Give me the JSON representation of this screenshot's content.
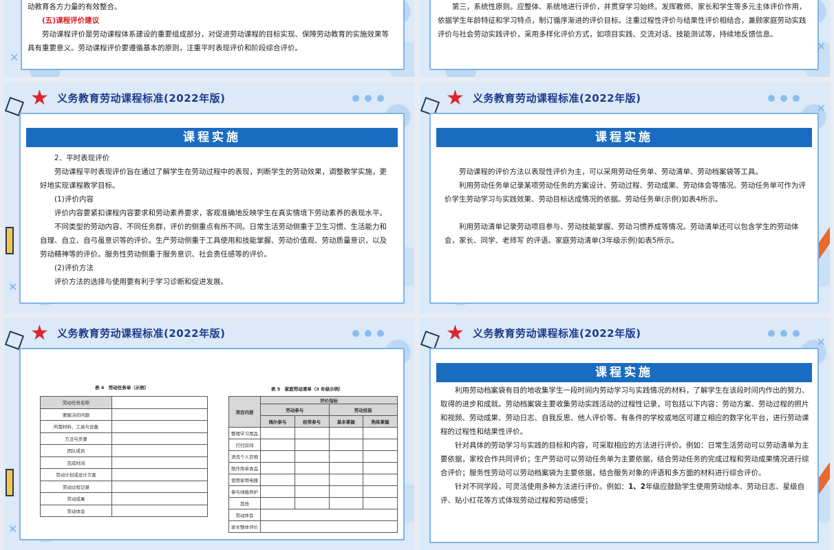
{
  "header_title": "义务教育劳动课程标准(2022年版)",
  "banner": "课程实施",
  "slide1": {
    "line1": "动教育各方力量的有效整合。",
    "heading": "(五)课程评价建议",
    "para": "劳动课程评价是劳动课程体系建设的重要组成部分，对促进劳动课程的目标实现、保障劳动教育的实施效果等具有重要意义。劳动课程评价要遵循基本的原则，注重平时表现评价和阶段综合评价。"
  },
  "slide2": {
    "para": "第三，系统性原则。应整体、系统地进行评价，并贯穿学习始终。发挥教师、家长和学生等多元主体评价作用，依据学生年龄特征和学习特点，制订循序渐进的评价目标。注重过程性评价与结果性评价相结合，兼顾家庭劳动实践评价与社会劳动实践评价，采用多样化评价方式，如项目实践、交流对话、技能测试等，持续地反馈信息。"
  },
  "slide3": {
    "h1": "2．平时表现评价",
    "p1": "劳动课程平时表现评价旨在通过了解学生在劳动过程中的表现，判断学生的劳动效果，调整教学实施，更好地实现课程教学目标。",
    "h2": "(1)评价内容",
    "p2": "评价内容要紧扣课程内容要求和劳动素养要求，客观准确地反映学生在真实情境下劳动素养的表现水平。",
    "p3": "不同类型的劳动内容、不同任务群，评价的侧重点有所不同。日常生活劳动侧重于卫生习惯、生活能力和自理、自立、自弓虽意识等的评价。生产劳动侧重于工具使用和技能掌握、劳动价值观、劳动质量意识，以及劳动精神等的评价。服务性劳动侧重于服务意识、社会责任感等的评价。",
    "h3": "(2)评价方法",
    "p4": "评价方法的选择与使用要有利于学习诊断和促进发展。"
  },
  "slide4": {
    "p1": "劳动课程的评价方法以表现性评价为主，可以采用劳动任务单、劳动清单、劳动档案袋等工具。",
    "p2": "利用劳动任务单记录某项劳动任务的方案设计、劳动过程、劳动成果、劳动体会等情况。劳动任务单可作为评价学生劳动学习与实践效果、劳动目标达成情况的依据。劳动任务单(示例)如表4所示。",
    "p3": "利用劳动清单记录劳动项目参与、劳动技能掌握、劳动习惯养成等情况。劳动清单还可以包含学生的劳动体会，家长、同学、老师写 的评语。家庭劳动清单(3年级示例)如表5所示。"
  },
  "slide5": {
    "table4": {
      "caption": "表 4　劳动任务单（示例）",
      "header": "劳动任务名称",
      "rows": [
        "要解决的问题",
        "所需材料、工具与设备",
        "方法与步骤",
        "团队成员",
        "完成时间",
        "劳动计划或设计方案",
        "劳动过程记录",
        "劳动成果",
        "劳动体会"
      ]
    },
    "table5": {
      "caption": "表 5　家庭劳动清单（3 年级示例）",
      "col_item": "项目内容",
      "col_index": "评价指标",
      "col_part": "劳动参与",
      "col_skill": "劳动技能",
      "sub": [
        "偶尔参与",
        "经常参与",
        "基本掌握",
        "熟练掌握"
      ],
      "rows": [
        "整理学习用品",
        "打扫房间",
        "清洗个人衣物",
        "制作简单食品",
        "使用家用电器",
        "参与绿植养护",
        "其他"
      ],
      "foot1": "劳动体会",
      "foot2": "家长整体评价"
    }
  },
  "slide6": {
    "p1": "利用劳动档案袋有目的地收集学生一段时间内劳动学习与实践情况的材料，了解学生在该段时间内作出的努力、取得的进步和成就。劳动档案袋主要收集劳动实践活动的过程性记录，可包括以下内容：劳动方案、劳动过程的照片和视频、劳动成果、劳动日志、自我反思、他人评价等。有条件的学校或地区可建立相应的数字化平台，进行劳动课程的过程性和结果性评价。",
    "p2": "针对具体的劳动学习与实践的目标和内容，可采取相应的方法进行评价。例如：日常生活劳动可以劳动清单为主要依据，家校合作共同评价；生产劳动可以劳动任务单为主要依据，结合劳动任务的完成过程和劳动成果情况进行综合评价；服务性劳动可以劳动档案袋为主要依据，结合服务对象的评语和多方面的材料进行综合评价。",
    "p3_a": "针对不同学段，可灵活使用多种方法进行评价。例如：",
    "p3_b": "1、2",
    "p3_c": "年级应鼓励学生使用劳动绘本、劳动日志、星级自评、贴小红花等方式体现劳动过程和劳动感受；"
  }
}
